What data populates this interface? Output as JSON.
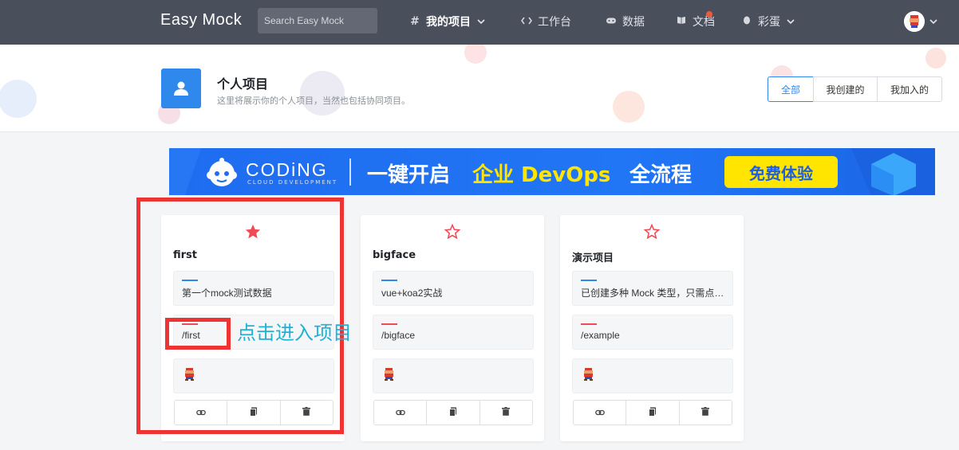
{
  "nav": {
    "logo": "Easy Mock",
    "search_placeholder": "Search Easy Mock",
    "items": [
      {
        "label": "我的项目",
        "icon": "hash-icon",
        "active": true,
        "caret": true
      },
      {
        "label": "工作台",
        "icon": "code-icon",
        "active": false,
        "caret": false
      },
      {
        "label": "数据",
        "icon": "gamepad-icon",
        "active": false,
        "caret": false
      },
      {
        "label": "文档",
        "icon": "book-icon",
        "active": false,
        "caret": false,
        "badge": true
      },
      {
        "label": "彩蛋",
        "icon": "egg-icon",
        "active": false,
        "caret": true
      }
    ]
  },
  "header": {
    "title": "个人项目",
    "subtitle": "这里将展示你的个人项目，当然也包括协同项目。",
    "filters": [
      {
        "label": "全部",
        "active": true
      },
      {
        "label": "我创建的",
        "active": false
      },
      {
        "label": "我加入的",
        "active": false
      }
    ]
  },
  "banner": {
    "brand": "CODiNG",
    "brand_sub": "CLOUD DEVELOPMENT",
    "t1": "一键开启",
    "t2": "企业 DevOps",
    "t3": "全流程",
    "cta": "免费体验"
  },
  "projects": [
    {
      "name": "first",
      "starred": true,
      "description": "第一个mock测试数据",
      "url": "/first"
    },
    {
      "name": "bigface",
      "starred": false,
      "description": "vue+koa2实战",
      "url": "/bigface"
    },
    {
      "name": "演示项目",
      "starred": false,
      "description": "已创建多种 Mock 类型，只需点击此处查看",
      "url": "/example"
    }
  ],
  "annotation": {
    "text": "点击进入项目"
  },
  "colors": {
    "nav_bg": "#4a4f5c",
    "primary": "#2f88eb",
    "star": "#ef4b56",
    "annotation_red": "#ee3333",
    "annotation_text": "#1fb2d6",
    "banner_yellow": "#ffe500"
  }
}
